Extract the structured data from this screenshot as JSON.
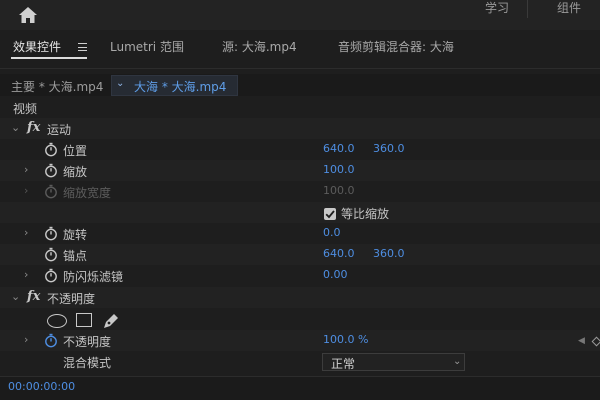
{
  "topbar": {
    "home_icon": "home-icon",
    "workspaces": [
      "学习",
      "组件"
    ]
  },
  "tabs": [
    {
      "label": "效果控件",
      "active": true
    },
    {
      "label": "Lumetri 范围",
      "active": false
    },
    {
      "label": "源: 大海.mp4",
      "active": false
    },
    {
      "label": "音频剪辑混合器: 大海",
      "active": false
    }
  ],
  "clip_header": {
    "master": "主要 * 大海.mp4",
    "selected": "大海 * 大海.mp4"
  },
  "section": "视频",
  "motion": {
    "name": "运动",
    "position": {
      "label": "位置",
      "x": "640.0",
      "y": "360.0"
    },
    "scale": {
      "label": "缩放",
      "value": "100.0"
    },
    "scale_width": {
      "label": "缩放宽度",
      "value": "100.0"
    },
    "uniform_scale": {
      "label": "等比缩放",
      "checked": true
    },
    "rotation": {
      "label": "旋转",
      "value": "0.0"
    },
    "anchor": {
      "label": "锚点",
      "x": "640.0",
      "y": "360.0"
    },
    "antiflicker": {
      "label": "防闪烁滤镜",
      "value": "0.00"
    }
  },
  "opacity": {
    "name": "不透明度",
    "mask_tools": [
      "ellipse-mask-icon",
      "rectangle-mask-icon",
      "pen-mask-icon"
    ],
    "opacity": {
      "label": "不透明度",
      "value": "100.0 %"
    },
    "blend_mode": {
      "label": "混合模式",
      "value": "正常"
    }
  },
  "footer": {
    "timecode": "00:00:00:00"
  },
  "colors": {
    "accent": "#4e8ee2",
    "background": "#1e1e1e"
  }
}
